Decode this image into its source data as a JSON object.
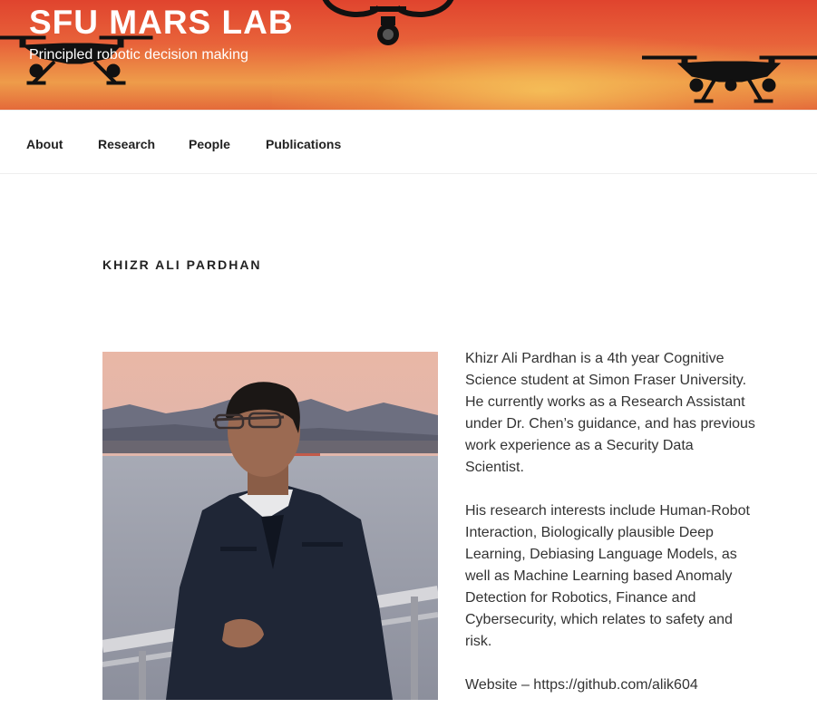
{
  "site": {
    "title": "SFU MARS LAB",
    "tagline": "Principled robotic decision making"
  },
  "nav": {
    "items": [
      {
        "label": "About"
      },
      {
        "label": "Research"
      },
      {
        "label": "People"
      },
      {
        "label": "Publications"
      }
    ]
  },
  "page": {
    "title": "KHIZR ALI PARDHAN",
    "bio_paragraphs": [
      "Khizr Ali Pardhan is a 4th year Cognitive Science student at Simon Fraser University. He currently works as a Research Assistant under Dr. Chen’s guidance, and has previous work experience as a Security Data Scientist.",
      "His research interests include Human-Robot Interaction, Biologically plausible Deep Learning, Debiasing Language Models, as well as Machine Learning based Anomaly Detection for Robotics, Finance and Cybersecurity, which relates to safety and risk."
    ],
    "website_line": "Website – https://github.com/alik604"
  },
  "colors": {
    "header_red": "#e0442e",
    "header_orange": "#ee9c4a",
    "nav_text": "#222222",
    "body_text": "#333333"
  },
  "icons": [
    "drone-icon"
  ]
}
